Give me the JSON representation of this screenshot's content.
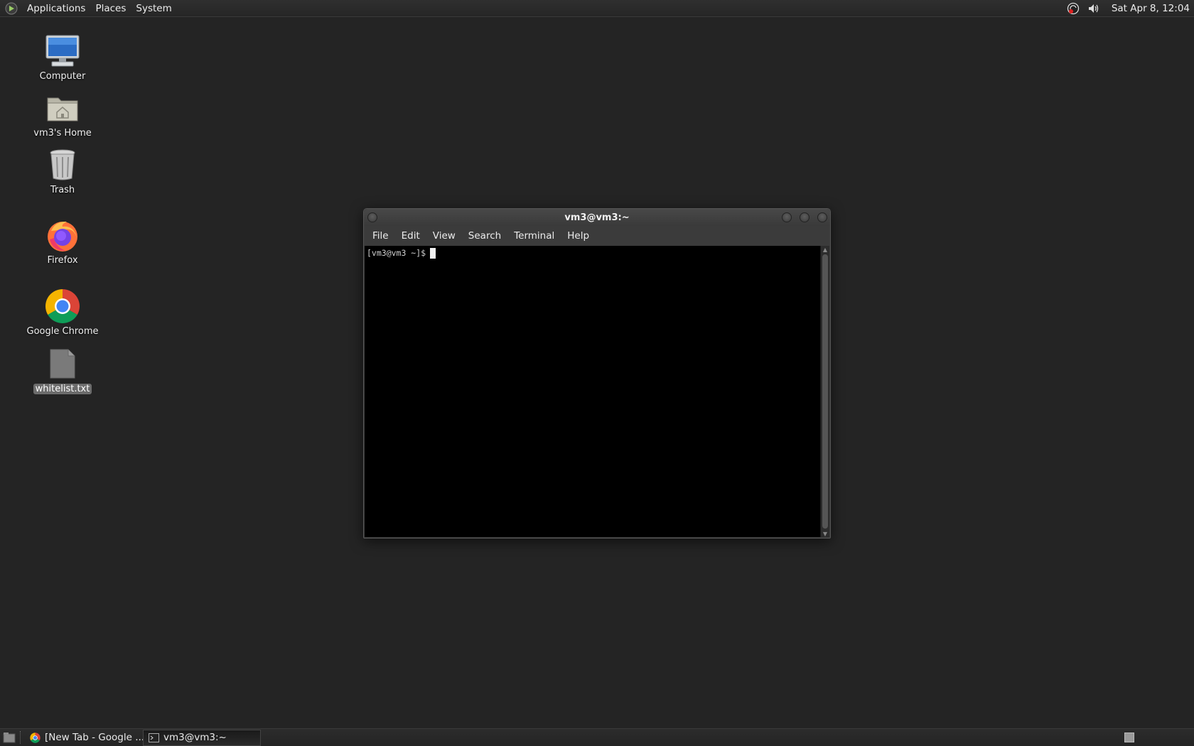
{
  "top_panel": {
    "menus": [
      "Applications",
      "Places",
      "System"
    ],
    "clock": "Sat Apr  8, 12:04"
  },
  "desktop": {
    "icons": [
      {
        "label": "Computer",
        "icon": "computer-icon"
      },
      {
        "label": "vm3's Home",
        "icon": "home-folder-icon"
      },
      {
        "label": "Trash",
        "icon": "trash-icon"
      },
      {
        "label": "Firefox",
        "icon": "firefox-icon"
      },
      {
        "label": "Google Chrome",
        "icon": "chrome-icon"
      },
      {
        "label": "whitelist.txt",
        "icon": "text-file-icon"
      }
    ]
  },
  "terminal": {
    "title": "vm3@vm3:~",
    "menus": [
      "File",
      "Edit",
      "View",
      "Search",
      "Terminal",
      "Help"
    ],
    "prompt": "[vm3@vm3 ~]$"
  },
  "taskbar": {
    "tasks": [
      {
        "label": "[New Tab - Google ...",
        "icon": "chrome-icon",
        "active": false
      },
      {
        "label": "vm3@vm3:~",
        "icon": "terminal-icon",
        "active": true
      }
    ]
  },
  "colors": {
    "desktop_bg": "#242424",
    "terminal_bg": "#000000",
    "selection": "#6c6c6c"
  }
}
